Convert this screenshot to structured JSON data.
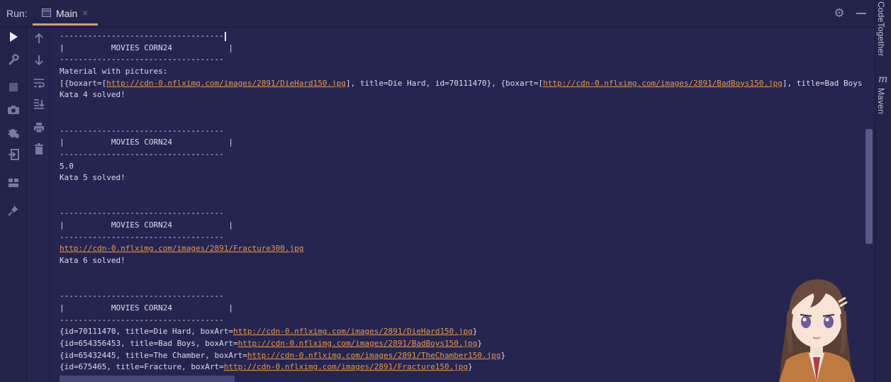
{
  "header": {
    "run_label": "Run:",
    "tab_label": "Main",
    "tab_close": "×"
  },
  "right_panel": {
    "codetogether_label": "CodeTogether",
    "maven_label": "Maven"
  },
  "icons": [
    "run-icon",
    "wrench-icon",
    "stop-icon",
    "camera-icon",
    "debug-icon",
    "exit-icon",
    "layout-icon",
    "pin-icon",
    "arrow-up-icon",
    "arrow-down-icon",
    "soft-wrap-icon",
    "scroll-to-end-icon",
    "print-icon",
    "trash-icon",
    "gear-icon",
    "minimize-icon"
  ],
  "colors": {
    "background": "#262550",
    "link": "#e59a47",
    "tab_underline": "#d4a26a"
  },
  "console": {
    "lines": [
      {
        "text": "-----------------------------------",
        "caret": true
      },
      {
        "text": "|          MOVIES CORN24            |"
      },
      {
        "text": "-----------------------------------"
      },
      {
        "text": "Material with pictures:"
      },
      {
        "parts": [
          {
            "t": "[{boxart=["
          },
          {
            "t": "http://cdn-0.nflximg.com/images/2891/DieHard150.jpg",
            "link": true
          },
          {
            "t": "], title=Die Hard, id=70111470}, {boxart=["
          },
          {
            "t": "http://cdn-0.nflximg.com/images/2891/BadBoys150.jpg",
            "link": true
          },
          {
            "t": "], title=Bad Boys"
          }
        ]
      },
      {
        "text": "Kata 4 solved!"
      },
      {
        "text": ""
      },
      {
        "text": ""
      },
      {
        "text": "-----------------------------------"
      },
      {
        "text": "|          MOVIES CORN24            |"
      },
      {
        "text": "-----------------------------------"
      },
      {
        "text": "5.0"
      },
      {
        "text": "Kata 5 solved!"
      },
      {
        "text": ""
      },
      {
        "text": ""
      },
      {
        "text": "-----------------------------------"
      },
      {
        "text": "|          MOVIES CORN24            |"
      },
      {
        "text": "-----------------------------------"
      },
      {
        "parts": [
          {
            "t": "http://cdn-0.nflximg.com/images/2891/Fracture300.jpg",
            "link": true
          }
        ]
      },
      {
        "text": "Kata 6 solved!"
      },
      {
        "text": ""
      },
      {
        "text": ""
      },
      {
        "text": "-----------------------------------"
      },
      {
        "text": "|          MOVIES CORN24            |"
      },
      {
        "text": "-----------------------------------"
      },
      {
        "parts": [
          {
            "t": "{id=70111470, title=Die Hard, boxArt="
          },
          {
            "t": "http://cdn-0.nflximg.com/images/2891/DieHard150.jpg",
            "link": true
          },
          {
            "t": "}"
          }
        ]
      },
      {
        "parts": [
          {
            "t": "{id=654356453, title=Bad Boys, boxArt="
          },
          {
            "t": "http://cdn-0.nflximg.com/images/2891/BadBoys150.jpg",
            "link": true
          },
          {
            "t": "}"
          }
        ]
      },
      {
        "parts": [
          {
            "t": "{id=65432445, title=The Chamber, boxArt="
          },
          {
            "t": "http://cdn-0.nflximg.com/images/2891/TheChamber150.jpg",
            "link": true
          },
          {
            "t": "}"
          }
        ]
      },
      {
        "parts": [
          {
            "t": "{id=675465, title=Fracture, boxArt="
          },
          {
            "t": "http://cdn-0.nflximg.com/images/2891/Fracture150.jpg",
            "link": true
          },
          {
            "t": "}"
          }
        ]
      }
    ]
  }
}
